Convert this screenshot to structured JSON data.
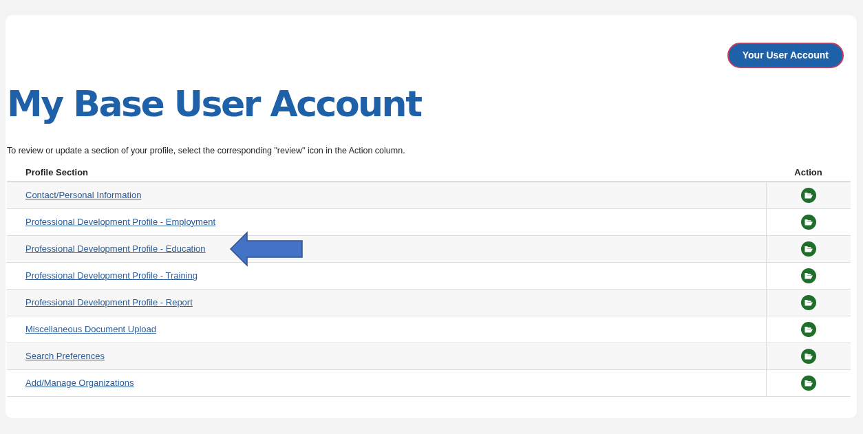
{
  "account_button": {
    "label": "Your User Account"
  },
  "title": "My Base User Account",
  "instructions": "To review or update a section of your profile, select the corresponding \"review\" icon in the Action column.",
  "table": {
    "columns": [
      "Profile Section",
      "Action"
    ],
    "rows": [
      {
        "section": "Contact/Personal Information"
      },
      {
        "section": "Professional Development Profile - Employment"
      },
      {
        "section": "Professional Development Profile - Education"
      },
      {
        "section": "Professional Development Profile - Training"
      },
      {
        "section": "Professional Development Profile - Report"
      },
      {
        "section": "Miscellaneous Document Upload"
      },
      {
        "section": "Search Preferences"
      },
      {
        "section": "Add/Manage Organizations"
      }
    ]
  }
}
